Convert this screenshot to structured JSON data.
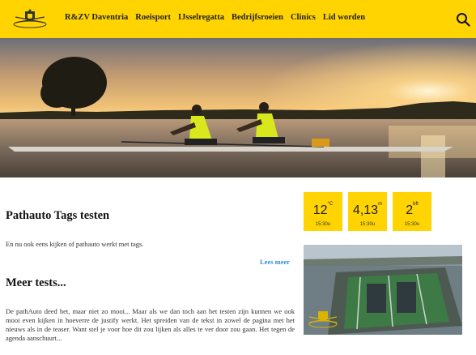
{
  "nav": {
    "items": [
      {
        "label": "R&ZV Daventria"
      },
      {
        "label": "Roeisport"
      },
      {
        "label": "IJsselregatta"
      },
      {
        "label": "Bedrijfsroeien"
      },
      {
        "label": "Clinics"
      },
      {
        "label": "Lid worden"
      }
    ],
    "search_icon": "search-icon",
    "logo_icon": "club-crest-icon"
  },
  "weather": {
    "temperature": {
      "value": "12",
      "unit": "°C",
      "time": "15:30u"
    },
    "water_level": {
      "value": "4,13",
      "unit": "m",
      "time": "15:30u"
    },
    "wind": {
      "value": "2",
      "unit": "bft",
      "time": "15:30u"
    }
  },
  "articles": [
    {
      "title": "Pathauto Tags testen",
      "text": "En nu ook eens kijken of pathauto werkt met tags.",
      "read_more": "Lees meer"
    },
    {
      "title": "Meer tests...",
      "text": "De pathAuto deed het, maar niet zo mooi... Maar als we dan toch aan het testen zijn kunnen we ook mooi even kijken in hoeverre de justify werkt. Het spreiden van de tekst in zowel de pagina met het nieuws als in de teaser. Want stel je voor hoe dit zou lijken als alles te ver door zou gaan. Het tegen de agenda aanschuurt..."
    }
  ],
  "colors": {
    "brand_yellow": "#ffd400",
    "link_blue": "#2a8fd8"
  }
}
